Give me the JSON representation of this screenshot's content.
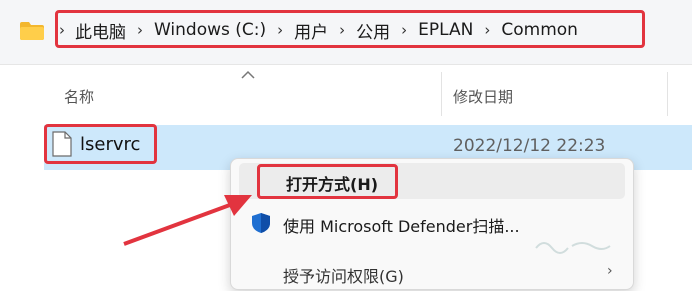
{
  "address_bar": {
    "breadcrumbs": [
      "此电脑",
      "Windows (C:)",
      "用户",
      "公用",
      "EPLAN",
      "Common"
    ],
    "separator": "›"
  },
  "columns": {
    "name": "名称",
    "date": "修改日期"
  },
  "file": {
    "name": "lservrc",
    "modified": "2022/12/12 22:23"
  },
  "context_menu": {
    "items": [
      {
        "label": "打开方式(H)",
        "icon": "none"
      },
      {
        "label": "使用 Microsoft Defender扫描...",
        "icon": "shield-icon"
      },
      {
        "label": "授予访问权限(G)",
        "icon": "none",
        "submenu": "›"
      }
    ]
  },
  "colors": {
    "highlight": "#e2343f",
    "selection": "#cde8fb"
  }
}
